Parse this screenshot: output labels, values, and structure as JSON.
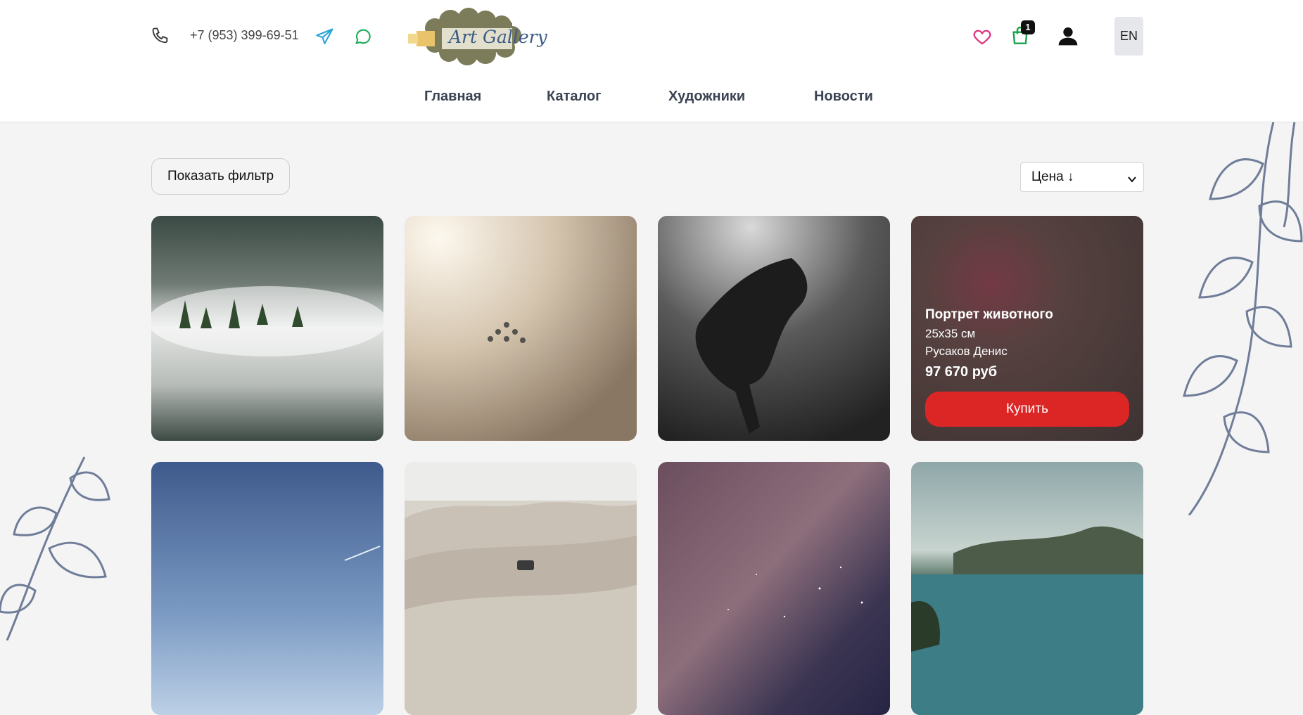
{
  "header": {
    "phone": "+7 (953) 399-69-51",
    "logo_text": "Art Gallery",
    "cart_count": "1",
    "lang": "EN"
  },
  "nav": {
    "items": [
      "Главная",
      "Каталог",
      "Художники",
      "Новости"
    ]
  },
  "toolbar": {
    "filter_label": "Показать фильтр",
    "sort_value": "Цена ↓"
  },
  "featured_card": {
    "title": "Портрет животного",
    "size": "25x35 см",
    "artist": "Русаков Денис",
    "price": "97 670 руб",
    "buy_label": "Купить"
  },
  "colors": {
    "accent_red": "#dc2626",
    "heart": "#e0337e",
    "cart": "#16a34a",
    "telegram": "#2aa3d8",
    "whatsapp": "#1faa59"
  }
}
